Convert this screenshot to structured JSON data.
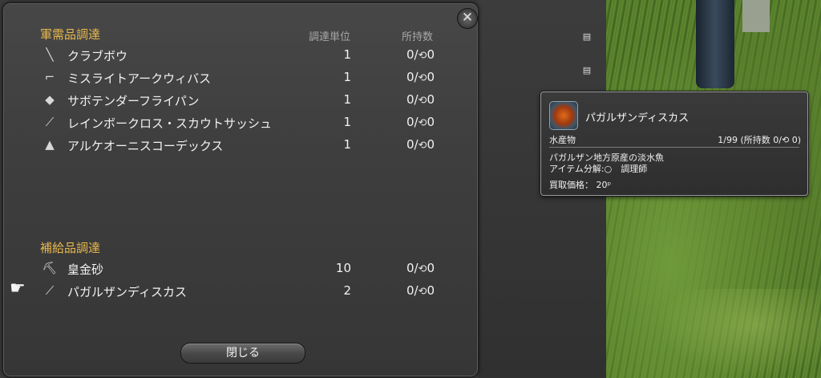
{
  "supply_window": {
    "section_military": "軍需品調達",
    "col_unit": "調達単位",
    "col_owned": "所持数",
    "military_items": [
      {
        "name": "クラブボウ",
        "unit": "1",
        "owned": "0/",
        "owned_hq": "0",
        "icon": "bow-icon"
      },
      {
        "name": "ミスライトアークウィバス",
        "unit": "1",
        "owned": "0/",
        "owned_hq": "0",
        "icon": "gun-icon"
      },
      {
        "name": "サボテンダーフライパン",
        "unit": "1",
        "owned": "0/",
        "owned_hq": "0",
        "icon": "shield-icon"
      },
      {
        "name": "レインボークロス・スカウトサッシュ",
        "unit": "1",
        "owned": "0/",
        "owned_hq": "0",
        "icon": "sash-icon"
      },
      {
        "name": "アルケオーニスコーデックス",
        "unit": "1",
        "owned": "0/",
        "owned_hq": "0",
        "icon": "book-icon"
      }
    ],
    "section_supply": "補給品調達",
    "supply_items": [
      {
        "name": "皇金砂",
        "unit": "10",
        "owned": "0/",
        "owned_hq": "0",
        "icon": "pickaxe-icon"
      },
      {
        "name": "パガルザンディスカス",
        "unit": "2",
        "owned": "0/",
        "owned_hq": "0",
        "icon": "fish-icon"
      }
    ],
    "close_label": "閉じる",
    "close_glyph": "✕",
    "hq_glyph": "⟲"
  },
  "tooltip": {
    "item_name": "パガルザンディスカス",
    "category": "水産物",
    "stack": "1/99 (所持数 0/⟲ 0)",
    "description": "パガルザン地方原産の淡水魚",
    "desynthesis": "アイテム分解:○　調理師",
    "price": "買取価格：  20ᵖ"
  },
  "pointer_glyph": "☛"
}
